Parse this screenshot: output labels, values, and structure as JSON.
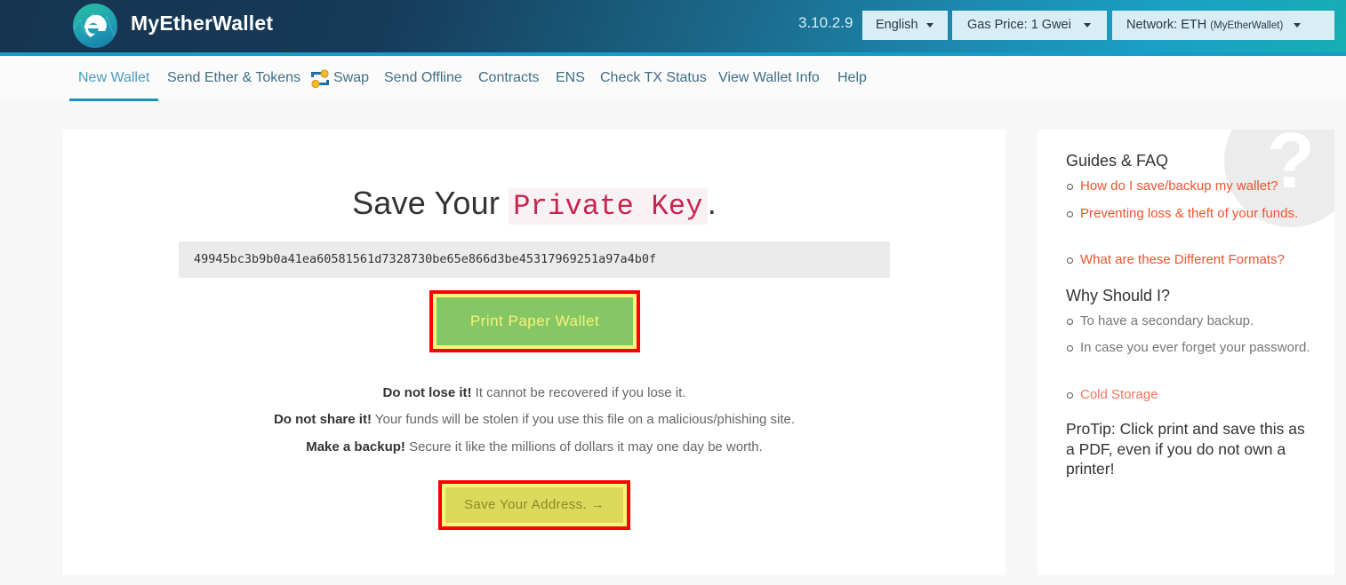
{
  "header": {
    "brand": "MyEtherWallet",
    "logo_icon": "myetherwallet-logo-icon",
    "version": "3.10.2.9",
    "language_dropdown": {
      "label": "English"
    },
    "gas_dropdown": {
      "label": "Gas Price: 1 Gwei"
    },
    "network_dropdown": {
      "label": "Network: ETH",
      "sub_label": "(MyEtherWallet)"
    },
    "colors": {
      "accent_line": "#149dc6",
      "dropdown_bg": "#d7eff4"
    }
  },
  "nav": {
    "items": [
      {
        "label": "New Wallet",
        "active": true
      },
      {
        "label": "Send Ether & Tokens",
        "active": false
      },
      {
        "label": "Swap",
        "active": false,
        "icon": "swap-icon"
      },
      {
        "label": "Send Offline",
        "active": false
      },
      {
        "label": "Contracts",
        "active": false
      },
      {
        "label": "ENS",
        "active": false
      },
      {
        "label": "Check TX Status",
        "active": false
      },
      {
        "label": "View Wallet Info",
        "active": false
      },
      {
        "label": "Help",
        "active": false
      }
    ]
  },
  "main": {
    "title_prefix": "Save Your ",
    "title_code": "Private Key",
    "title_suffix": ".",
    "private_key": "49945bc3b9b0a41ea60581561d7328730be65e866d3be45317969251a97a4b0f",
    "print_button": "Print Paper Wallet",
    "warnings": [
      {
        "bold": "Do not lose it!",
        "text": " It cannot be recovered if you lose it."
      },
      {
        "bold": "Do not share it!",
        "text": " Your funds will be stolen if you use this file on a malicious/phishing site."
      },
      {
        "bold": "Make a backup!",
        "text": " Secure it like the millions of dollars it may one day be worth."
      }
    ],
    "next_button": "Save Your Address. →",
    "colors": {
      "highlight_border": "#ff0000",
      "print_button_bg": "#86c765",
      "next_button_bg": "#dcd95c"
    }
  },
  "sidebar": {
    "decoration_icon": "question-mark-icon",
    "guides_heading": "Guides & FAQ",
    "guides": [
      "How do I save/backup my wallet?",
      "Preventing loss & theft of your funds.",
      "What are these Different Formats?"
    ],
    "why_heading": "Why Should I?",
    "why_items": [
      {
        "text": "To have a secondary backup.",
        "link": false
      },
      {
        "text": "In case you ever forget your password.",
        "link": false
      },
      {
        "text": "Cold Storage",
        "link": true
      }
    ],
    "protip": "ProTip: Click print and save this as a PDF, even if you do not own a printer!",
    "colors": {
      "link": "#f2522e"
    }
  }
}
